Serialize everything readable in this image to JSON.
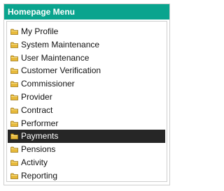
{
  "panel": {
    "title": "Homepage Menu",
    "accent_color": "#0aa48e"
  },
  "menu": {
    "items": [
      {
        "label": "My Profile",
        "icon": "folder-icon"
      },
      {
        "label": "System Maintenance",
        "icon": "folder-icon"
      },
      {
        "label": "User Maintenance",
        "icon": "folder-icon"
      },
      {
        "label": "Customer Verification",
        "icon": "folder-icon"
      },
      {
        "label": "Commissioner",
        "icon": "folder-icon"
      },
      {
        "label": "Provider",
        "icon": "folder-icon"
      },
      {
        "label": "Contract",
        "icon": "folder-icon"
      },
      {
        "label": "Performer",
        "icon": "folder-icon"
      },
      {
        "label": "Payments",
        "icon": "folder-icon",
        "selected": true
      },
      {
        "label": "Pensions",
        "icon": "folder-icon"
      },
      {
        "label": "Activity",
        "icon": "folder-icon"
      },
      {
        "label": "Reporting",
        "icon": "folder-icon"
      }
    ],
    "selected_color": "#262626"
  }
}
